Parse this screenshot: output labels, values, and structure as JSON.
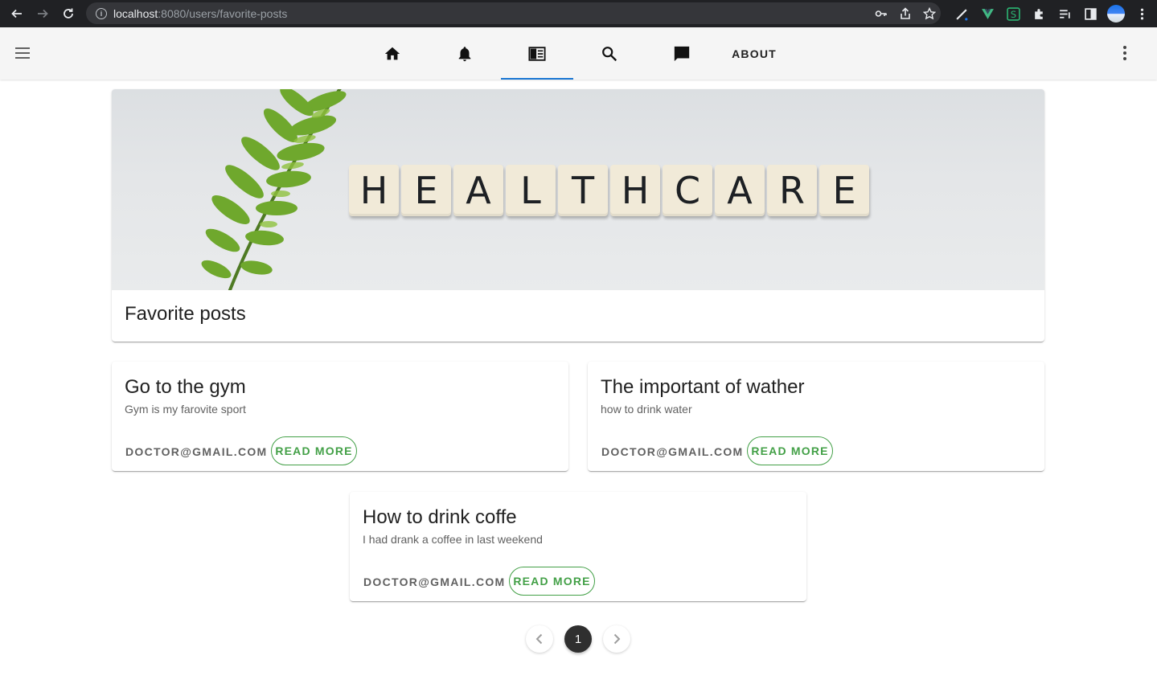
{
  "browser": {
    "url_host": "localhost",
    "url_rest": ":8080/users/favorite-posts"
  },
  "appbar": {
    "about_label": "ABOUT"
  },
  "hero": {
    "image_letters": [
      "H",
      "E",
      "A",
      "L",
      "T",
      "H",
      "C",
      "A",
      "R",
      "E"
    ],
    "title": "Favorite posts"
  },
  "posts": [
    {
      "title": "Go to the gym",
      "subtitle": "Gym is my farovite sport",
      "author": "DOCTOR@GMAIL.COM",
      "read_more": "READ MORE"
    },
    {
      "title": "The important of wather",
      "subtitle": "how to drink water",
      "author": "DOCTOR@GMAIL.COM",
      "read_more": "READ MORE"
    },
    {
      "title": "How to drink coffe",
      "subtitle": "I had drank a coffee in last weekend",
      "author": "DOCTOR@GMAIL.COM",
      "read_more": "READ MORE"
    }
  ],
  "pagination": {
    "current_page": "1"
  },
  "colors": {
    "accent_tab": "#1976d2",
    "read_more_green": "#43a047",
    "appbar_bg": "#f5f5f5",
    "chrome_bg": "#202124"
  }
}
